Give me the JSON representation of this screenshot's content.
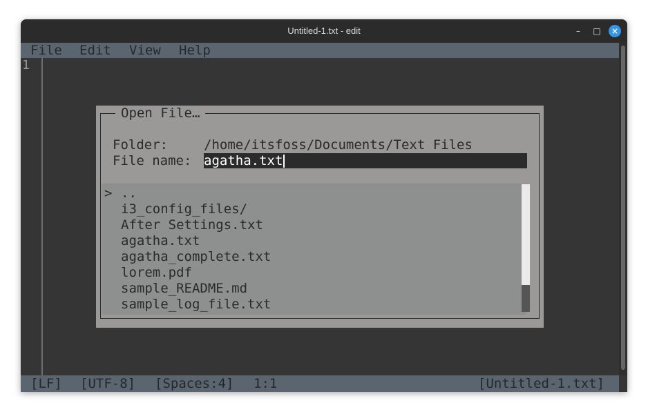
{
  "window": {
    "title": "Untitled-1.txt - edit"
  },
  "window_controls": {
    "minimize": "–",
    "maximize": "□",
    "close": "×"
  },
  "menu": {
    "items": [
      "File",
      "Edit",
      "View",
      "Help"
    ]
  },
  "editor": {
    "line_number": "1"
  },
  "dialog": {
    "title": "Open File…",
    "folder_label": "Folder:",
    "folder_value": "/home/itsfoss/Documents/Text Files",
    "filename_label": "File name:",
    "filename_value": "agatha.txt",
    "selected_marker": ">",
    "files": [
      "..",
      "i3_config_files/",
      "After Settings.txt",
      "agatha.txt",
      "agatha_complete.txt",
      "lorem.pdf",
      "sample_README.md",
      "sample_log_file.txt"
    ]
  },
  "status": {
    "line_ending": "[LF]",
    "encoding": "[UTF-8]",
    "indent": "[Spaces:4]",
    "position": "1:1",
    "filename": "[Untitled-1.txt]"
  }
}
